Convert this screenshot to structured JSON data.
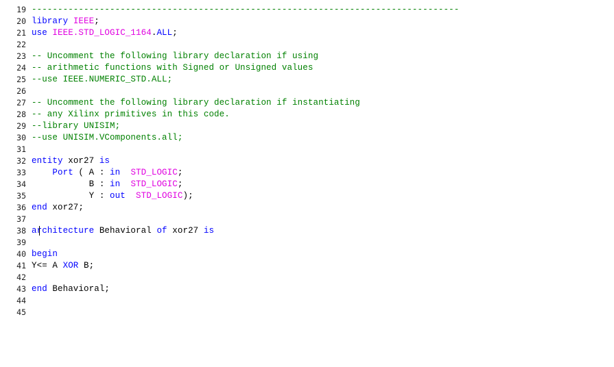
{
  "editor": {
    "lines": [
      {
        "num": "19",
        "segs": [
          {
            "t": "----------------------------------------------------------------------------------",
            "c": "cm"
          }
        ]
      },
      {
        "num": "20",
        "segs": [
          {
            "t": "library ",
            "c": "kw"
          },
          {
            "t": "IEEE",
            "c": "ty"
          },
          {
            "t": ";",
            "c": ""
          }
        ]
      },
      {
        "num": "21",
        "segs": [
          {
            "t": "use ",
            "c": "kw"
          },
          {
            "t": "IEEE.STD_LOGIC_1164",
            "c": "ty"
          },
          {
            "t": ".",
            "c": ""
          },
          {
            "t": "ALL",
            "c": "kw"
          },
          {
            "t": ";",
            "c": ""
          }
        ]
      },
      {
        "num": "22",
        "segs": []
      },
      {
        "num": "23",
        "segs": [
          {
            "t": "-- Uncomment the following library declaration if using",
            "c": "cm"
          }
        ]
      },
      {
        "num": "24",
        "segs": [
          {
            "t": "-- arithmetic functions with Signed or Unsigned values",
            "c": "cm"
          }
        ]
      },
      {
        "num": "25",
        "segs": [
          {
            "t": "--use IEEE.NUMERIC_STD.ALL;",
            "c": "cm"
          }
        ]
      },
      {
        "num": "26",
        "segs": []
      },
      {
        "num": "27",
        "segs": [
          {
            "t": "-- Uncomment the following library declaration if instantiating",
            "c": "cm"
          }
        ]
      },
      {
        "num": "28",
        "segs": [
          {
            "t": "-- any Xilinx primitives in this code.",
            "c": "cm"
          }
        ]
      },
      {
        "num": "29",
        "segs": [
          {
            "t": "--library UNISIM;",
            "c": "cm"
          }
        ]
      },
      {
        "num": "30",
        "segs": [
          {
            "t": "--use UNISIM.VComponents.all;",
            "c": "cm"
          }
        ]
      },
      {
        "num": "31",
        "segs": []
      },
      {
        "num": "32",
        "segs": [
          {
            "t": "entity ",
            "c": "kw"
          },
          {
            "t": "xor27 ",
            "c": ""
          },
          {
            "t": "is",
            "c": "kw"
          }
        ]
      },
      {
        "num": "33",
        "segs": [
          {
            "t": "    Port ",
            "c": "kw"
          },
          {
            "t": "( A : ",
            "c": ""
          },
          {
            "t": "in",
            "c": "kw"
          },
          {
            "t": "  ",
            "c": ""
          },
          {
            "t": "STD_LOGIC",
            "c": "ty"
          },
          {
            "t": ";",
            "c": ""
          }
        ]
      },
      {
        "num": "34",
        "segs": [
          {
            "t": "           B : ",
            "c": ""
          },
          {
            "t": "in",
            "c": "kw"
          },
          {
            "t": "  ",
            "c": ""
          },
          {
            "t": "STD_LOGIC",
            "c": "ty"
          },
          {
            "t": ";",
            "c": ""
          }
        ]
      },
      {
        "num": "35",
        "segs": [
          {
            "t": "           Y : ",
            "c": ""
          },
          {
            "t": "out",
            "c": "kw"
          },
          {
            "t": "  ",
            "c": ""
          },
          {
            "t": "STD_LOGIC",
            "c": "ty"
          },
          {
            "t": ");",
            "c": ""
          }
        ]
      },
      {
        "num": "36",
        "segs": [
          {
            "t": "end ",
            "c": "kw"
          },
          {
            "t": "xor27;",
            "c": ""
          }
        ]
      },
      {
        "num": "37",
        "segs": []
      },
      {
        "num": "38",
        "segs": [
          {
            "t": "architecture ",
            "c": "kw"
          },
          {
            "t": "Behavioral ",
            "c": ""
          },
          {
            "t": "of ",
            "c": "kw"
          },
          {
            "t": "xor27 ",
            "c": ""
          },
          {
            "t": "is",
            "c": "kw"
          }
        ]
      },
      {
        "num": "39",
        "segs": []
      },
      {
        "num": "40",
        "segs": [
          {
            "t": "begin",
            "c": "kw"
          }
        ]
      },
      {
        "num": "41",
        "segs": [
          {
            "t": "Y<= A ",
            "c": ""
          },
          {
            "t": "XOR",
            "c": "kw"
          },
          {
            "t": " B;",
            "c": ""
          }
        ]
      },
      {
        "num": "42",
        "segs": []
      },
      {
        "num": "43",
        "segs": [
          {
            "t": "end ",
            "c": "kw"
          },
          {
            "t": "Behavioral;",
            "c": ""
          }
        ]
      },
      {
        "num": "44",
        "segs": []
      },
      {
        "num": "45",
        "segs": []
      }
    ]
  }
}
